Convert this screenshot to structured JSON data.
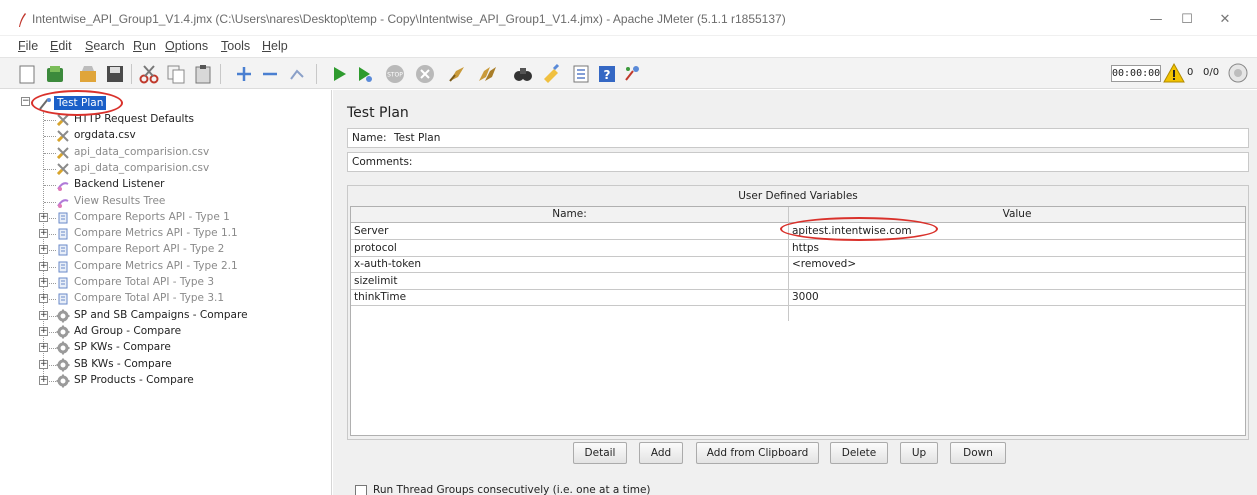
{
  "window": {
    "title": "Intentwise_API_Group1_V1.4.jmx (C:\\Users\\nares\\Desktop\\temp - Copy\\Intentwise_API_Group1_V1.4.jmx) - Apache JMeter (5.1.1 r1855137)",
    "minimize": "—",
    "maximize": "☐",
    "close": "✕"
  },
  "menu": [
    "File",
    "Edit",
    "Search",
    "Run",
    "Options",
    "Tools",
    "Help"
  ],
  "toolbar": {
    "timer": "00:00:00",
    "warning_count": "0",
    "thread_count": "0/0",
    "icons": [
      "new-icon",
      "templates-icon",
      "open-icon",
      "save-icon",
      "cut-icon",
      "copy-icon",
      "paste-icon",
      "expand-icon",
      "collapse-icon",
      "toggle-icon",
      "start-icon",
      "start-no-pause-icon",
      "stop-icon",
      "shutdown-icon",
      "clear-icon",
      "clear-all-icon",
      "search-icon",
      "reset-search-icon",
      "function-helper-icon",
      "help-icon",
      "remote-icon"
    ]
  },
  "tree": {
    "root": "Test Plan",
    "items": [
      {
        "label": "HTTP Request Defaults",
        "icon": "config-icon",
        "expandable": false,
        "enabled": true
      },
      {
        "label": "orgdata.csv",
        "icon": "config-icon",
        "expandable": false,
        "enabled": true
      },
      {
        "label": "api_data_comparision.csv",
        "icon": "config-icon",
        "expandable": false,
        "enabled": false
      },
      {
        "label": "api_data_comparision.csv",
        "icon": "config-icon",
        "expandable": false,
        "enabled": false
      },
      {
        "label": "Backend Listener",
        "icon": "listener-icon",
        "expandable": false,
        "enabled": true
      },
      {
        "label": "View Results Tree",
        "icon": "listener-icon",
        "expandable": false,
        "enabled": false
      },
      {
        "label": "Compare Reports API -  Type 1",
        "icon": "controller-icon",
        "expandable": true,
        "enabled": false
      },
      {
        "label": "Compare Metrics API -  Type 1.1",
        "icon": "controller-icon",
        "expandable": true,
        "enabled": false
      },
      {
        "label": "Compare Report API -  Type 2",
        "icon": "controller-icon",
        "expandable": true,
        "enabled": false
      },
      {
        "label": "Compare Metrics API -  Type 2.1",
        "icon": "controller-icon",
        "expandable": true,
        "enabled": false
      },
      {
        "label": "Compare Total API -  Type 3",
        "icon": "controller-icon",
        "expandable": true,
        "enabled": false
      },
      {
        "label": "Compare Total API -  Type 3.1",
        "icon": "controller-icon",
        "expandable": true,
        "enabled": false
      },
      {
        "label": "SP and SB Campaigns - Compare",
        "icon": "thread-group-icon",
        "expandable": true,
        "enabled": true
      },
      {
        "label": "Ad Group - Compare",
        "icon": "thread-group-icon",
        "expandable": true,
        "enabled": true
      },
      {
        "label": "SP KWs - Compare",
        "icon": "thread-group-icon",
        "expandable": true,
        "enabled": true
      },
      {
        "label": "SB KWs - Compare",
        "icon": "thread-group-icon",
        "expandable": true,
        "enabled": true
      },
      {
        "label": "SP Products - Compare",
        "icon": "thread-group-icon",
        "expandable": true,
        "enabled": true
      }
    ]
  },
  "panel": {
    "title": "Test Plan",
    "name_label": "Name:",
    "name_value": "Test Plan",
    "comments_label": "Comments:",
    "udv_title": "User Defined Variables",
    "columns": [
      "Name:",
      "Value"
    ],
    "rows": [
      [
        "Server",
        "apitest.intentwise.com"
      ],
      [
        "protocol",
        "https"
      ],
      [
        "x-auth-token",
        "<removed>"
      ],
      [
        "sizelimit",
        ""
      ],
      [
        "thinkTime",
        "3000"
      ]
    ],
    "buttons": [
      "Detail",
      "Add",
      "Add from Clipboard",
      "Delete",
      "Up",
      "Down"
    ],
    "checkbox_label": "Run Thread Groups consecutively (i.e. one at a time)"
  },
  "colors": {
    "selection": "#1a5fc8",
    "annotation": "#d9312b",
    "disabled_text": "#8a8a8a"
  }
}
